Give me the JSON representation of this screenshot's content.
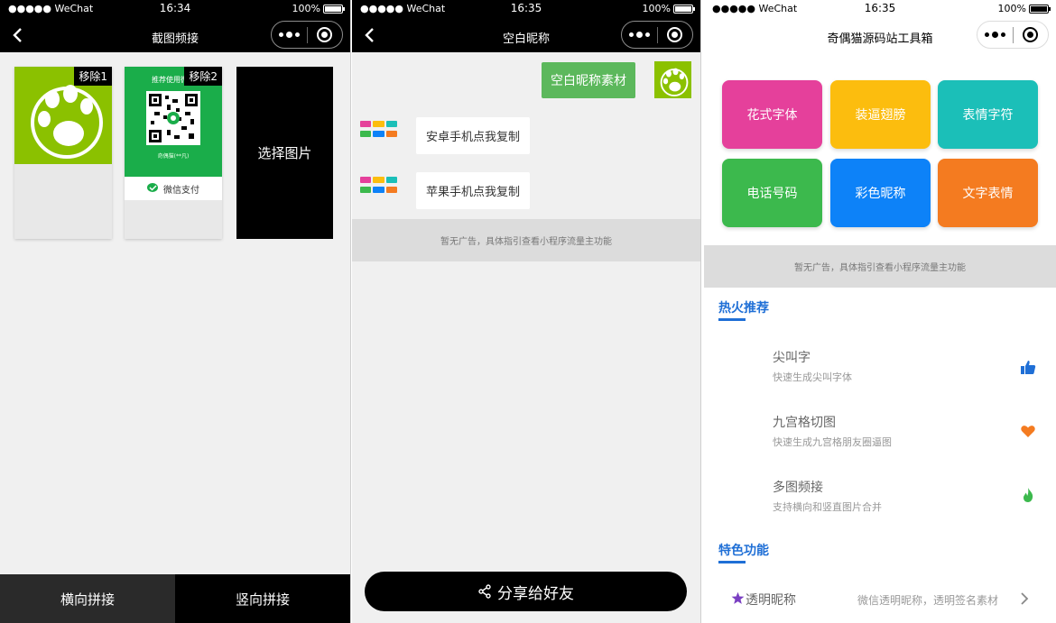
{
  "status_bar": {
    "carrier": "●●●●● WeChat",
    "battery": "100%",
    "times": [
      "16:34",
      "16:35",
      "16:35"
    ]
  },
  "screen1": {
    "title": "截图频接",
    "remove1": "移除1",
    "remove2": "移除2",
    "qr_caption": "推荐使用微信",
    "qr_sub": "奇偶猫(**凡)",
    "wechat_pay": "微信支付",
    "select_image": "选择图片",
    "horizontal": "横向拼接",
    "vertical": "竖向拼接"
  },
  "screen2": {
    "title": "空白昵称",
    "material": "空白昵称素材",
    "android": "安卓手机点我复制",
    "apple": "苹果手机点我复制",
    "ad": "暂无广告，具体指引查看小程序流量主功能",
    "share": "分享给好友"
  },
  "screen3": {
    "title": "奇偶猫源码站工具箱",
    "tiles": [
      {
        "label": "花式字体",
        "color": "#e5409b"
      },
      {
        "label": "装逼翅膀",
        "color": "#fcbd0e"
      },
      {
        "label": "表情字符",
        "color": "#1bbfb8"
      },
      {
        "label": "电话号码",
        "color": "#3cb94d"
      },
      {
        "label": "彩色昵称",
        "color": "#0d82f8"
      },
      {
        "label": "文字表情",
        "color": "#f47b20"
      }
    ],
    "ad": "暂无广告，具体指引查看小程序流量主功能",
    "hot_title": "热火推荐",
    "recommendations": [
      {
        "title": "尖叫字",
        "desc": "快速生成尖叫字体",
        "icon": "thumbs-up-icon"
      },
      {
        "title": "九宫格切图",
        "desc": "快速生成九宫格朋友圈逼图",
        "icon": "heart-icon"
      },
      {
        "title": "多图频接",
        "desc": "支持横向和竖直图片合并",
        "icon": "flame-icon"
      }
    ],
    "featured_title": "特色功能",
    "featured": {
      "title": "透明昵称",
      "desc": "微信透明昵称，透明签名素材"
    }
  }
}
